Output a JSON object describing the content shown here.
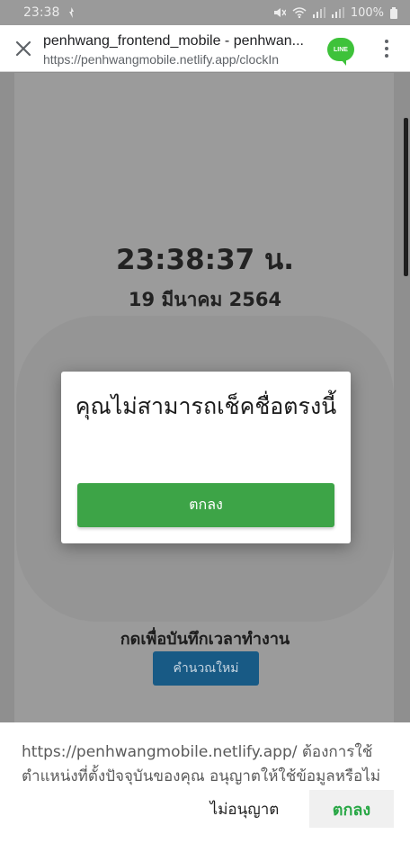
{
  "status_bar": {
    "time": "23:38",
    "battery": "100%"
  },
  "browser": {
    "title": "penhwang_frontend_mobile - penhwan...",
    "url": "https://penhwangmobile.netlify.app/clockIn",
    "app_badge": "LINE"
  },
  "page": {
    "clock_time": "23:38:37 น.",
    "clock_date": "19 มีนาคม 2564",
    "press_label": "กดเพื่อบันทึกเวลาทำงาน",
    "recalc_button": "คำนวณใหม่"
  },
  "modal": {
    "message": "คุณไม่สามารถเช็คชื่อตรงนี้",
    "ok_button": "ตกลง"
  },
  "permission": {
    "text": "https://penhwangmobile.netlify.app/ ต้องการใช้ตำแหน่งที่ตั้งปัจจุบันของคุณ อนุญาตให้ใช้ข้อมูลหรือไม่",
    "deny_button": "ไม่อนุญาต",
    "allow_button": "ตกลง"
  },
  "colors": {
    "modal_button": "#3da447",
    "recalc_button": "#185a85",
    "allow_text": "#28a745",
    "line_brand": "#3ec23a"
  }
}
